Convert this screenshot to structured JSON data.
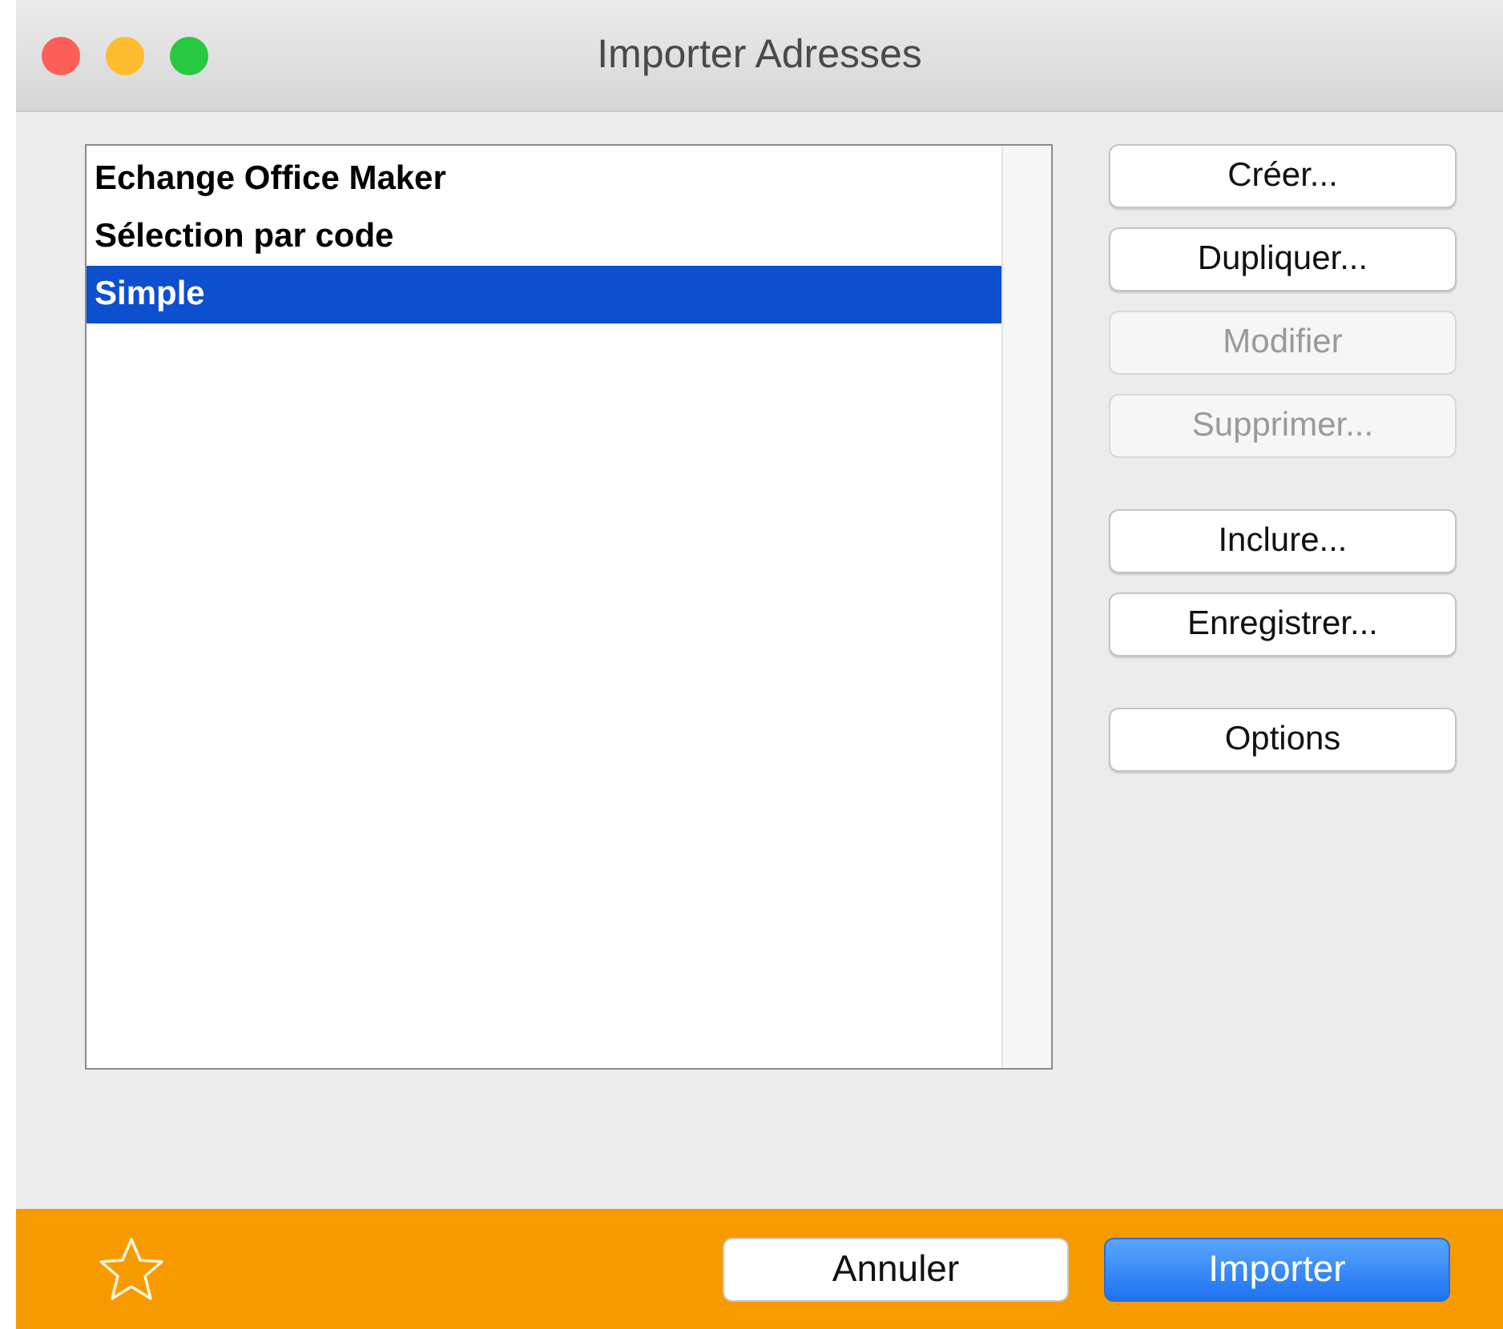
{
  "window": {
    "title": "Importer Adresses"
  },
  "list": {
    "items": [
      {
        "label": "Echange Office Maker",
        "selected": false
      },
      {
        "label": "Sélection par code",
        "selected": false
      },
      {
        "label": "Simple",
        "selected": true
      }
    ]
  },
  "button_groups": [
    [
      {
        "label": "Créer...",
        "disabled": false
      },
      {
        "label": "Dupliquer...",
        "disabled": false
      },
      {
        "label": "Modifier",
        "disabled": true
      },
      {
        "label": "Supprimer...",
        "disabled": true
      }
    ],
    [
      {
        "label": "Inclure...",
        "disabled": false
      },
      {
        "label": "Enregistrer...",
        "disabled": false
      }
    ],
    [
      {
        "label": "Options",
        "disabled": false
      }
    ]
  ],
  "footer": {
    "buttons": [
      {
        "label": "Annuler",
        "kind": "secondary"
      },
      {
        "label": "Importer",
        "kind": "primary"
      }
    ]
  }
}
